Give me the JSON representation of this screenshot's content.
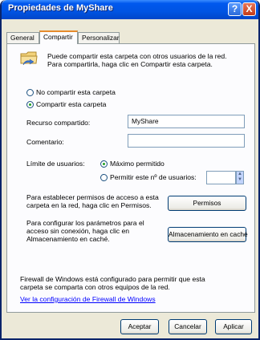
{
  "window": {
    "title": "Propiedades de MyShare",
    "help_glyph": "?",
    "close_glyph": "X"
  },
  "tabs": [
    {
      "label": "General"
    },
    {
      "label": "Compartir"
    },
    {
      "label": "Personalizar"
    }
  ],
  "intro": "Puede compartir esta carpeta con otros usuarios de la red. Para compartirla, haga clic en Compartir esta carpeta.",
  "share_options": {
    "no_share": "No compartir esta carpeta",
    "share": "Compartir esta carpeta"
  },
  "fields": {
    "share_name_label": "Recurso compartido:",
    "share_name_value": "MyShare",
    "comment_label": "Comentario:",
    "comment_value": ""
  },
  "user_limit": {
    "label": "Límite de usuarios:",
    "max_option": "Máximo permitido",
    "allow_option": "Permitir este nº de usuarios:",
    "count_value": ""
  },
  "permissions": {
    "text": "Para establecer permisos de acceso a esta carpeta en la red, haga clic en Permisos.",
    "button": "Permisos"
  },
  "caching": {
    "text": "Para configurar los parámetros para el acceso sin conexión, haga clic en Almacenamiento en caché.",
    "button": "Almacenamiento en caché"
  },
  "firewall": {
    "text": "Firewall de Windows está configurado para permitir que esta carpeta se comparta con otros equipos de la red.",
    "link": "Ver la configuración de Firewall de Windows"
  },
  "buttons": {
    "ok": "Aceptar",
    "cancel": "Cancelar",
    "apply": "Aplicar"
  },
  "icons": {
    "folder": "shared-folder-icon"
  },
  "colors": {
    "titlebar": "#0054e3",
    "close": "#c43b17",
    "tab_accent": "#e68b2c"
  }
}
